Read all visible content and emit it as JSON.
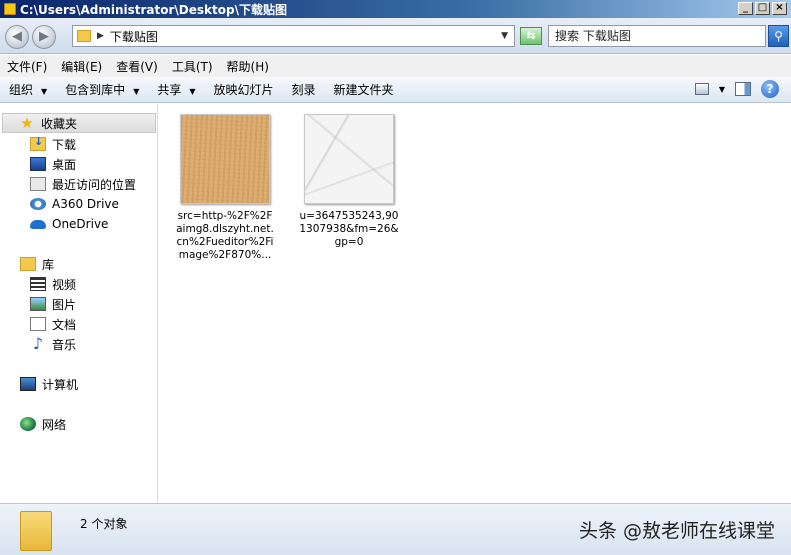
{
  "window": {
    "title": "C:\\Users\\Administrator\\Desktop\\下载贴图",
    "btn_min": "_",
    "btn_max": "□",
    "btn_close": "×"
  },
  "address": {
    "path": "下载贴图",
    "search_placeholder": "搜索 下载贴图"
  },
  "menu": [
    "文件(F)",
    "编辑(E)",
    "查看(V)",
    "工具(T)",
    "帮助(H)"
  ],
  "toolbar": {
    "organize": "组织",
    "include_in_library": "包含到库中",
    "share": "共享",
    "slideshow": "放映幻灯片",
    "burn": "刻录",
    "new_folder": "新建文件夹"
  },
  "nav": {
    "favorites": "收藏夹",
    "downloads": "下载",
    "desktop": "桌面",
    "recent": "最近访问的位置",
    "a360": "A360 Drive",
    "onedrive": "OneDrive",
    "libraries": "库",
    "videos": "视频",
    "pictures": "图片",
    "documents": "文档",
    "music": "音乐",
    "computer": "计算机",
    "network": "网络"
  },
  "files": [
    {
      "name": "src=http-%2F%2Faimg8.dlszyht.net.cn%2Fueditor%2Fimage%2F870%...",
      "thumb": "wood-texture"
    },
    {
      "name": "u=3647535243,901307938&fm=26&gp=0",
      "thumb": "marble-texture"
    }
  ],
  "status": {
    "count": "2 个对象"
  },
  "watermark": "头条 @敖老师在线课堂"
}
